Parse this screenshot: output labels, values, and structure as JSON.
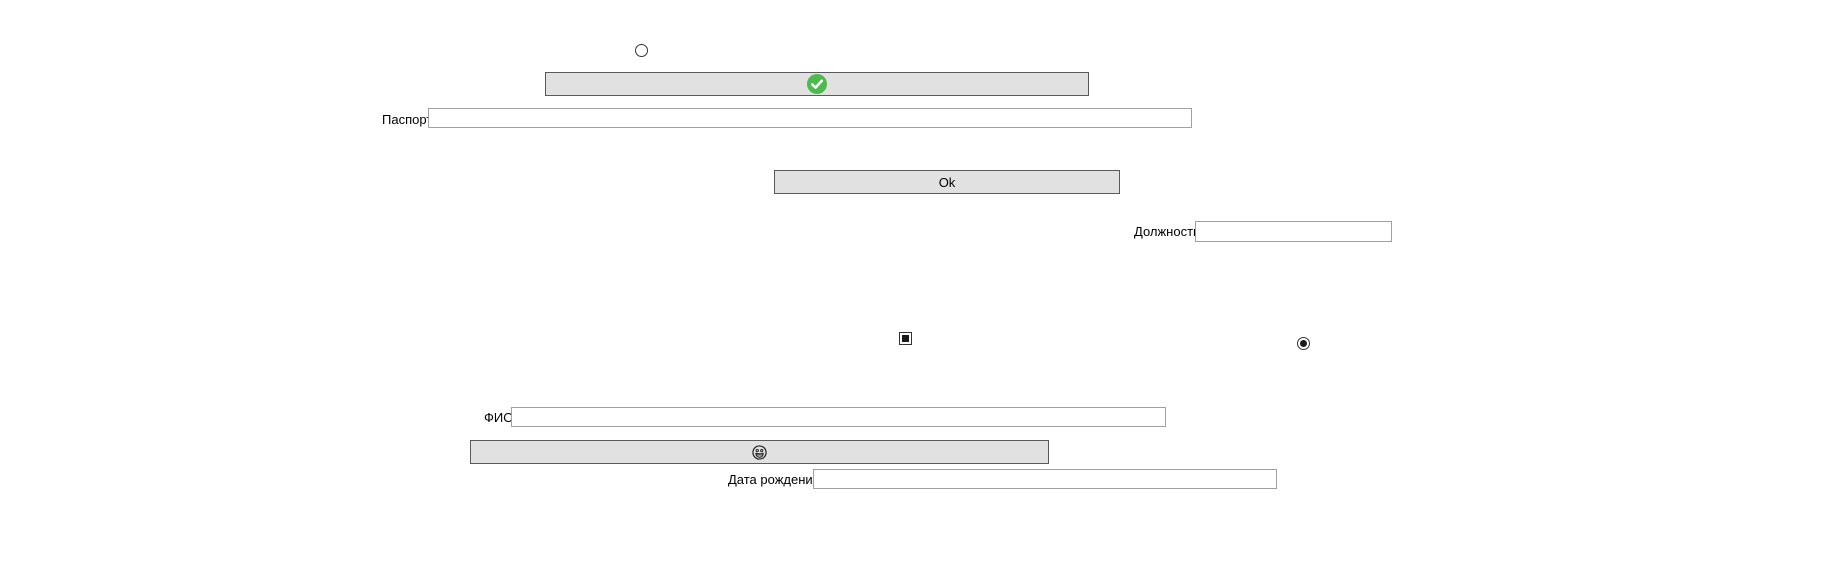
{
  "radio_top": {
    "checked": false
  },
  "check_button": {
    "icon": "check-circle-icon",
    "icon_color": "#4cba4c"
  },
  "passport": {
    "label": "Паспорт",
    "value": ""
  },
  "ok_button": {
    "label": "Ok"
  },
  "position": {
    "label": "Должность",
    "value": ""
  },
  "checkbox": {
    "state": "indeterminate"
  },
  "radio_right": {
    "checked": true
  },
  "fio": {
    "label": "ФИО",
    "value": ""
  },
  "emoji_button": {
    "icon": "grinning-face-icon"
  },
  "birth_date": {
    "label": "Дата рождения",
    "value": ""
  },
  "colors": {
    "button_bg": "#e1e1e1",
    "button_border": "#5a5a5a",
    "input_border": "#a0a0a0"
  }
}
